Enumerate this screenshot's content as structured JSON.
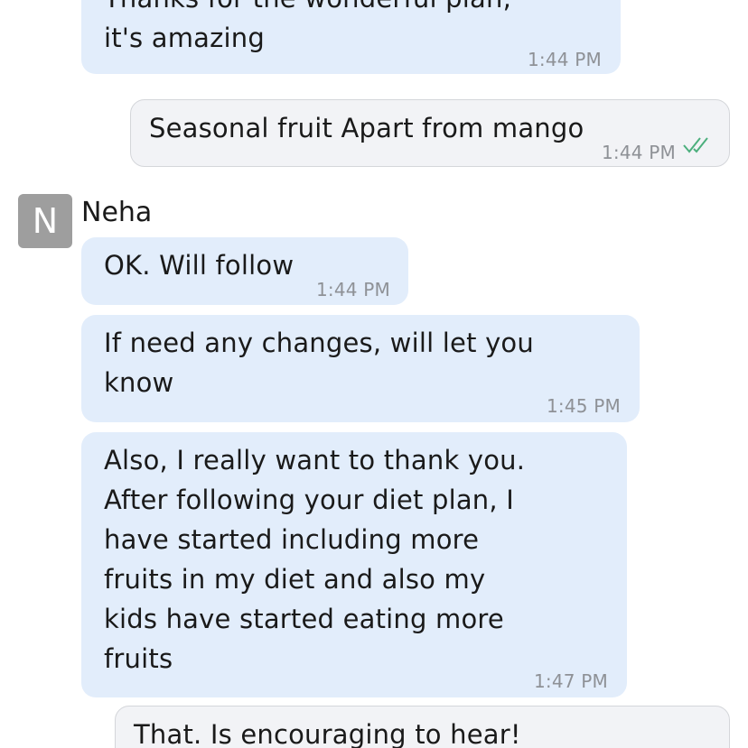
{
  "messages": [
    {
      "direction": "incoming",
      "text": "Thanks for the wonderful plan,\nit's amazing",
      "time": "1:44 PM"
    },
    {
      "direction": "outgoing",
      "text": "Seasonal  fruit Apart from mango",
      "time": "1:44 PM",
      "status_icon": "double-check-icon",
      "status_color": "#4caf7d"
    },
    {
      "direction": "incoming",
      "text": "OK. Will follow",
      "time": "1:44 PM"
    },
    {
      "direction": "incoming",
      "text": "If need any changes, will let you\nknow",
      "time": "1:45 PM"
    },
    {
      "direction": "incoming",
      "text": "Also, I really want to thank you.\nAfter following your diet plan, I\nhave started including more\nfruits in my diet and also my\nkids have started eating more\nfruits",
      "time": "1:47 PM"
    },
    {
      "direction": "outgoing",
      "text": "That. Is encouraging  to hear!"
    }
  ],
  "sender": {
    "name": "Neha",
    "initial": "N",
    "avatar_color": "#9e9e9e"
  },
  "colors": {
    "incoming_bubble": "#e2edfb",
    "outgoing_bubble": "#f2f3f6",
    "timestamp": "#8e9196"
  }
}
